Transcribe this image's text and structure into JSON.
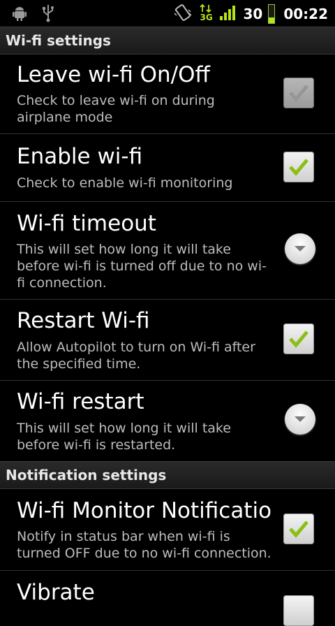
{
  "status_bar": {
    "icons": [
      "android-debug-icon",
      "usb-icon",
      "vibrate-icon",
      "data-3g-icon",
      "signal-icon"
    ],
    "network_label": "3G",
    "battery_level": "30",
    "battery_fraction": 0.3,
    "time": "00:22",
    "accent_color": "#b6e31c"
  },
  "sections": {
    "wifi_header": "Wi-fi settings",
    "notification_header": "Notification settings"
  },
  "items": [
    {
      "title": "Leave wi-fi On/Off",
      "summary": "Check to leave wi-fi on during airplane mode",
      "control": "checkbox",
      "checked": false,
      "disabled": true
    },
    {
      "title": "Enable wi-fi",
      "summary": "Check to enable wi-fi monitoring",
      "control": "checkbox",
      "checked": true
    },
    {
      "title": "Wi-fi timeout",
      "summary": "This will set how long it will take before wi-fi is turned off due to no wi-fi connection.",
      "control": "dropdown"
    },
    {
      "title": "Restart Wi-fi",
      "summary": "Allow Autopilot to turn on Wi-fi after the specified time.",
      "control": "checkbox",
      "checked": true
    },
    {
      "title": "Wi-fi restart",
      "summary": "This will set how long it will take before wi-fi is restarted.",
      "control": "dropdown"
    },
    {
      "title": "Wi-fi Monitor Notification",
      "summary": "Notify in status bar when wi-fi is turned OFF due to no wi-fi connection.",
      "control": "checkbox",
      "checked": true
    },
    {
      "title": "Vibrate",
      "summary": "",
      "control": "checkbox",
      "checked": false
    }
  ]
}
